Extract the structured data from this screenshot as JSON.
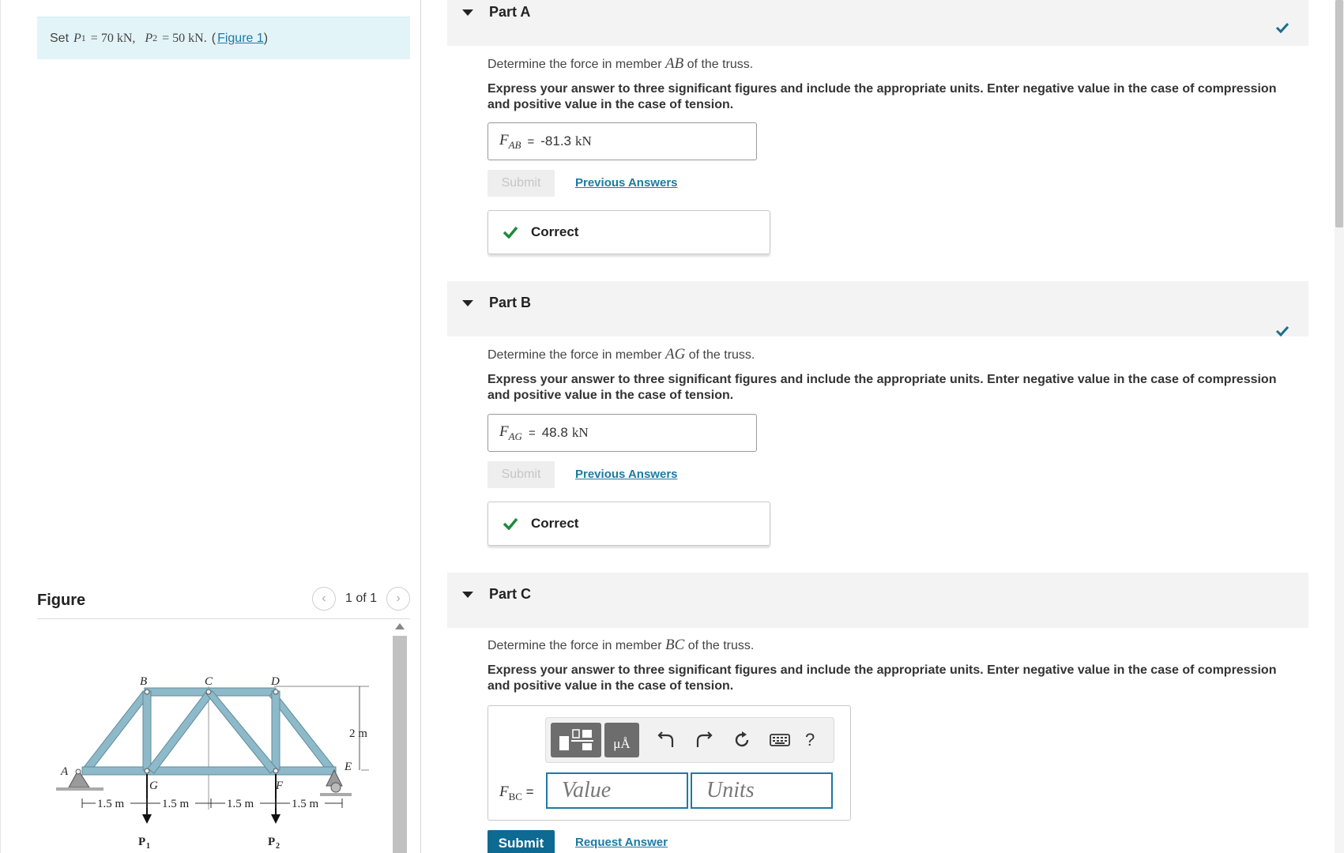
{
  "intro": {
    "prefix": "Set",
    "p1_sym": "P",
    "p1_sub": "1",
    "p1_val": "= 70 kN,",
    "p2_sym": "P",
    "p2_sub": "2",
    "p2_val": "= 50 kN.",
    "figure_link": "Figure 1"
  },
  "figure": {
    "title": "Figure",
    "pager": "1 of 1",
    "prev_icon": "‹",
    "next_icon": "›",
    "labels": {
      "A": "A",
      "B": "B",
      "C": "C",
      "D": "D",
      "E": "E",
      "F": "F",
      "G": "G",
      "height": "2 m",
      "span": "1.5 m",
      "p1": "P",
      "p1_sub": "1",
      "p2": "P",
      "p2_sub": "2"
    }
  },
  "parts": [
    {
      "title": "Part A",
      "question_prefix": "Determine the force in member",
      "member": "AB",
      "question_suffix": "of the truss.",
      "instructions": "Express your answer to three significant figures and include the appropriate units. Enter negative value in the case of compression and positive value in the case of tension.",
      "answer_sym": "F",
      "answer_sub": "AB",
      "answer_value": "-81.3",
      "answer_unit": "kN",
      "submit": "Submit",
      "prev_answers": "Previous Answers",
      "feedback": "Correct"
    },
    {
      "title": "Part B",
      "question_prefix": "Determine the force in member",
      "member": "AG",
      "question_suffix": "of the truss.",
      "instructions": "Express your answer to three significant figures and include the appropriate units. Enter negative value in the case of compression and positive value in the case of tension.",
      "answer_sym": "F",
      "answer_sub": "AG",
      "answer_value": "48.8",
      "answer_unit": "kN",
      "submit": "Submit",
      "prev_answers": "Previous Answers",
      "feedback": "Correct"
    },
    {
      "title": "Part C",
      "question_prefix": "Determine the force in member",
      "member": "BC",
      "question_suffix": "of the truss.",
      "instructions": "Express your answer to three significant figures and include the appropriate units. Enter negative value in the case of compression and positive value in the case of tension.",
      "answer_sym": "F",
      "answer_sub": "BC",
      "value_placeholder": "Value",
      "units_placeholder": "Units",
      "units_btn": "μÅ",
      "help": "?",
      "submit": "Submit",
      "request_answer": "Request Answer"
    }
  ],
  "colors": {
    "accent": "#1d7aa3",
    "correct_green": "#1e8a3c",
    "truss_member": "#8db9c9"
  }
}
